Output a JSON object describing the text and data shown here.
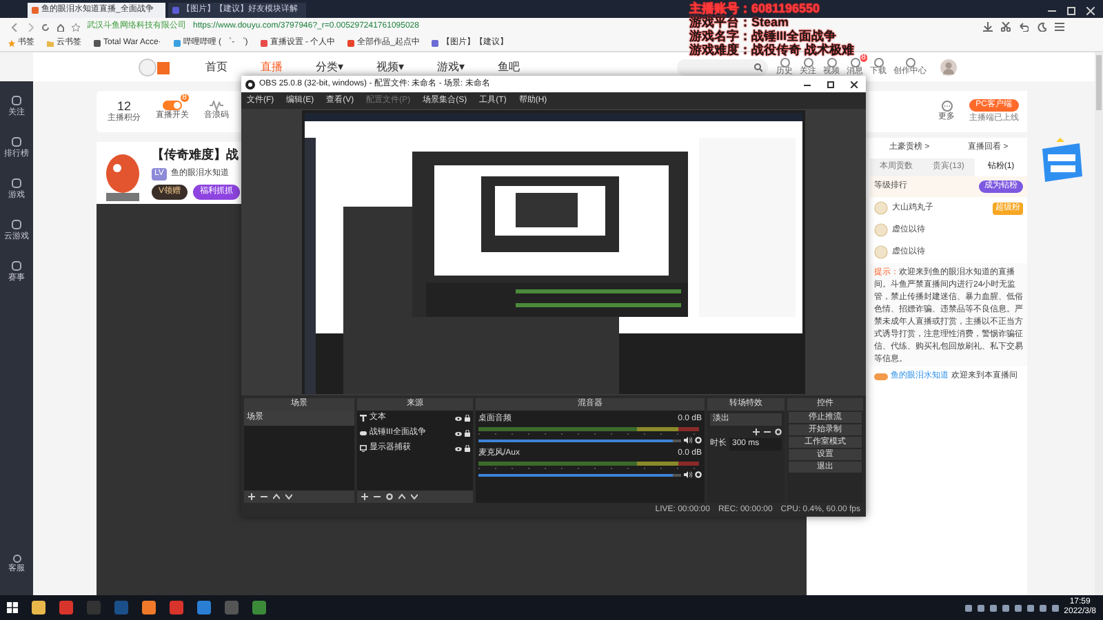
{
  "browser": {
    "tabs": [
      {
        "label": "鱼的眼泪水知道直播_全面战争",
        "selected": true
      },
      {
        "label": "【图片】【建议】好友模块详解",
        "selected": false
      }
    ],
    "address": {
      "site": "武汉斗鱼网络科技有限公司",
      "url": "https://www.douyu.com/3797946?_r=0.005297241761095028"
    },
    "bookmarks": [
      "书签",
      "云书签",
      "Total War Acce·",
      "哔哩哔哩 ( ゜- ゜)",
      "直播设置 - 个人中",
      "全部作品_起点中",
      "【图片】【建议】"
    ]
  },
  "nav": {
    "items": [
      {
        "label": "首页",
        "selected": false
      },
      {
        "label": "直播",
        "selected": true
      },
      {
        "label": "分类▾",
        "selected": false
      },
      {
        "label": "视频▾",
        "selected": false
      },
      {
        "label": "游戏▾",
        "selected": false
      },
      {
        "label": "鱼吧",
        "selected": false
      }
    ],
    "icons": [
      "历史",
      "关注",
      "视频",
      "消息",
      "下载",
      "创作中心"
    ],
    "message_badge": "8"
  },
  "sidebar": {
    "items": [
      "关注",
      "排行榜",
      "游戏",
      "云游戏",
      "赛事"
    ],
    "bottom": "客服"
  },
  "anchor_card": {
    "score": "12",
    "score_label": "主播积分",
    "switch_label": "直播开关",
    "switch_badge": "8",
    "audio_label": "音浪码",
    "more_label": "更多",
    "client_button": "PC客户端",
    "client_note": "主播端已上线"
  },
  "room": {
    "title": "【传奇难度】战",
    "level": "LV",
    "owner": "鱼的眼泪水知道",
    "buttons": [
      "V领赠",
      "福利抓抓"
    ]
  },
  "side_panel": {
    "links": [
      "土豪贡榜 >",
      "直播回看 >"
    ],
    "tabs": [
      {
        "label": "本周贡数",
        "selected": false
      },
      {
        "label": "贵宾(13)",
        "selected": false
      },
      {
        "label": "钻粉(1)",
        "selected": true
      }
    ],
    "rank_label": "等级排行",
    "join_button": "成为钻粉",
    "users": [
      {
        "name": "大山鸡丸子",
        "badge": "超级粉"
      },
      {
        "name": "虚位以待"
      },
      {
        "name": "虚位以待"
      }
    ],
    "notice_label": "提示：",
    "notice": "欢迎来到鱼的眼泪水知道的直播间。斗鱼严禁直播间内进行24小时无监管，禁止传播封建迷信、暴力血腥、低俗色情、招嫖诈骗、违禁品等不良信息。严禁未成年人直播或打赏，主播以不正当方式诱导打赏，注意理性消费，警惕诈骗征信、代练、购买礼包回放刷礼、私下交易等信息。",
    "chat": {
      "user": "鱼的眼泪水知道",
      "text": "欢迎来到本直播间"
    }
  },
  "overlay": {
    "lines": [
      {
        "label": "主播账号：",
        "value": "6081196550"
      },
      {
        "label": "游戏平台：",
        "value": "Steam"
      },
      {
        "label": "游戏名字：",
        "value": "战锤III全面战争"
      },
      {
        "label": "游戏难度：",
        "value": "战役传奇 战术极难"
      }
    ]
  },
  "obs": {
    "title": "OBS 25.0.8 (32-bit, windows) - 配置文件: 未命名 - 场景: 未命名",
    "menu": [
      {
        "label": "文件(F)",
        "disabled": false
      },
      {
        "label": "编辑(E)",
        "disabled": false
      },
      {
        "label": "查看(V)",
        "disabled": false
      },
      {
        "label": "配置文件(P)",
        "disabled": true
      },
      {
        "label": "场景集合(S)",
        "disabled": false
      },
      {
        "label": "工具(T)",
        "disabled": false
      },
      {
        "label": "帮助(H)",
        "disabled": false
      }
    ],
    "docks": [
      "场景",
      "来源",
      "混音器",
      "转场特效",
      "控件"
    ],
    "scenes": [
      {
        "label": "场景",
        "selected": true
      }
    ],
    "sources": [
      {
        "kind": "text",
        "label": "文本"
      },
      {
        "kind": "game",
        "label": "战锤III全面战争"
      },
      {
        "kind": "display",
        "label": "显示器捕获"
      }
    ],
    "mixer": [
      {
        "name": "桌面音频",
        "reading": "0.0 dB",
        "level": 0.96
      },
      {
        "name": "麦克风/Aux",
        "reading": "0.0 dB",
        "level": 0.96
      }
    ],
    "transition": {
      "value": "淡出",
      "duration_label": "时长",
      "duration": "300 ms"
    },
    "controls": [
      "停止推流",
      "开始录制",
      "工作室模式",
      "设置",
      "退出"
    ],
    "status": {
      "live": "LIVE: 00:00:00",
      "rec": "REC: 00:00:00",
      "cpu": "CPU: 0.4%, 60.00 fps"
    }
  },
  "taskbar": {
    "time": "17:59",
    "date": "2022/3/8"
  }
}
